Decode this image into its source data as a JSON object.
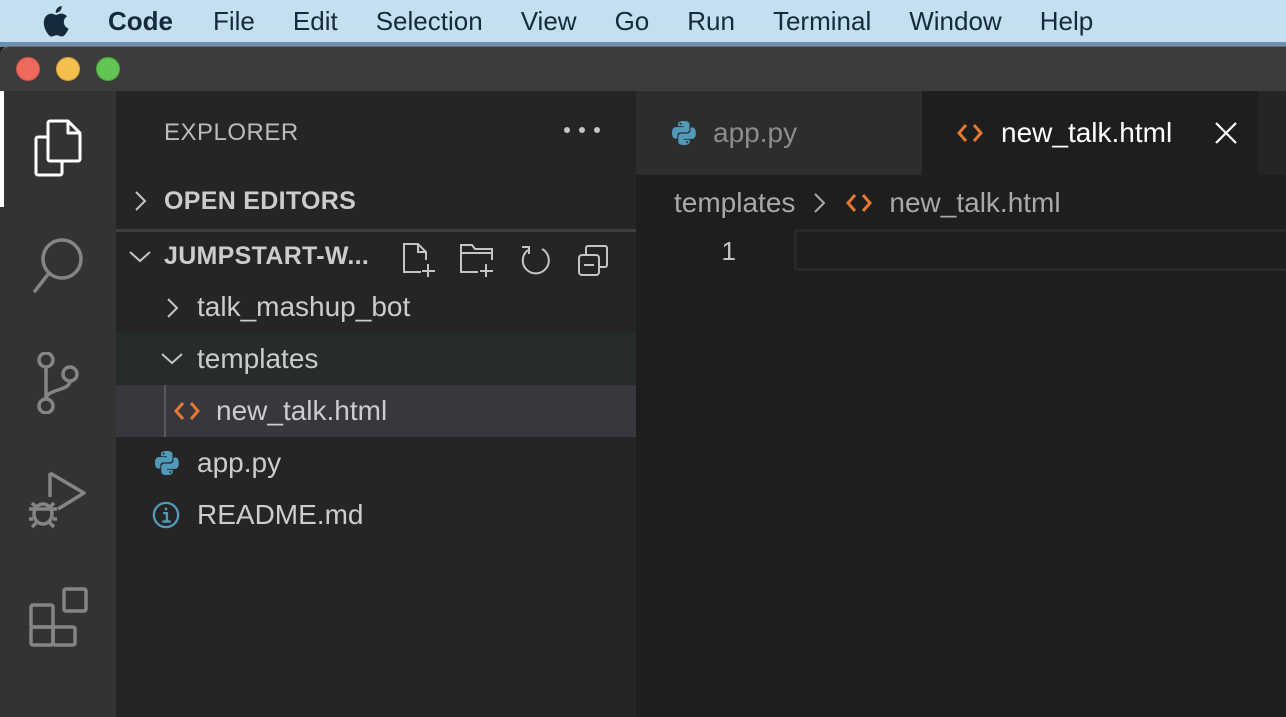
{
  "menubar": {
    "apple_icon": "apple-logo-icon",
    "app_name": "Code",
    "items": [
      "File",
      "Edit",
      "Selection",
      "View",
      "Go",
      "Run",
      "Terminal",
      "Window",
      "Help"
    ]
  },
  "window": {
    "traffic_lights": {
      "close": "#ee6a5e",
      "minimize": "#f5bf4f",
      "maximize": "#61c554"
    }
  },
  "activity_bar": {
    "items": [
      {
        "name": "explorer",
        "icon": "files-icon",
        "active": true
      },
      {
        "name": "search",
        "icon": "search-icon",
        "active": false
      },
      {
        "name": "source-control",
        "icon": "source-control-icon",
        "active": false
      },
      {
        "name": "run-and-debug",
        "icon": "run-debug-icon",
        "active": false
      },
      {
        "name": "extensions",
        "icon": "extensions-icon",
        "active": false
      }
    ]
  },
  "sidebar": {
    "title": "EXPLORER",
    "more_icon": "ellipsis-icon",
    "open_editors": {
      "label": "OPEN EDITORS",
      "expanded": false
    },
    "workspace": {
      "label": "JUMPSTART-W...",
      "expanded": true,
      "actions": [
        {
          "name": "new-file",
          "icon": "new-file-icon"
        },
        {
          "name": "new-folder",
          "icon": "new-folder-icon"
        },
        {
          "name": "refresh",
          "icon": "refresh-icon"
        },
        {
          "name": "collapse-all",
          "icon": "collapse-all-icon"
        }
      ]
    },
    "tree": [
      {
        "label": "talk_mashup_bot",
        "type": "folder",
        "expanded": false
      },
      {
        "label": "templates",
        "type": "folder",
        "expanded": true
      },
      {
        "label": "new_talk.html",
        "type": "html",
        "selected": true,
        "parent": "templates"
      },
      {
        "label": "app.py",
        "type": "python"
      },
      {
        "label": "README.md",
        "type": "info"
      }
    ]
  },
  "editor": {
    "tabs": [
      {
        "label": "app.py",
        "icon": "python-icon",
        "active": false
      },
      {
        "label": "new_talk.html",
        "icon": "html-icon",
        "active": true,
        "close_icon": "close-icon"
      }
    ],
    "breadcrumb": [
      {
        "label": "templates"
      },
      {
        "label": "new_talk.html",
        "icon": "html-icon"
      }
    ],
    "line_numbers": [
      "1"
    ],
    "content": ""
  },
  "colors": {
    "html_icon": "#e37933",
    "python_icon": "#519aba",
    "info_icon": "#519aba",
    "menubar_bg": "#c3dff0"
  }
}
